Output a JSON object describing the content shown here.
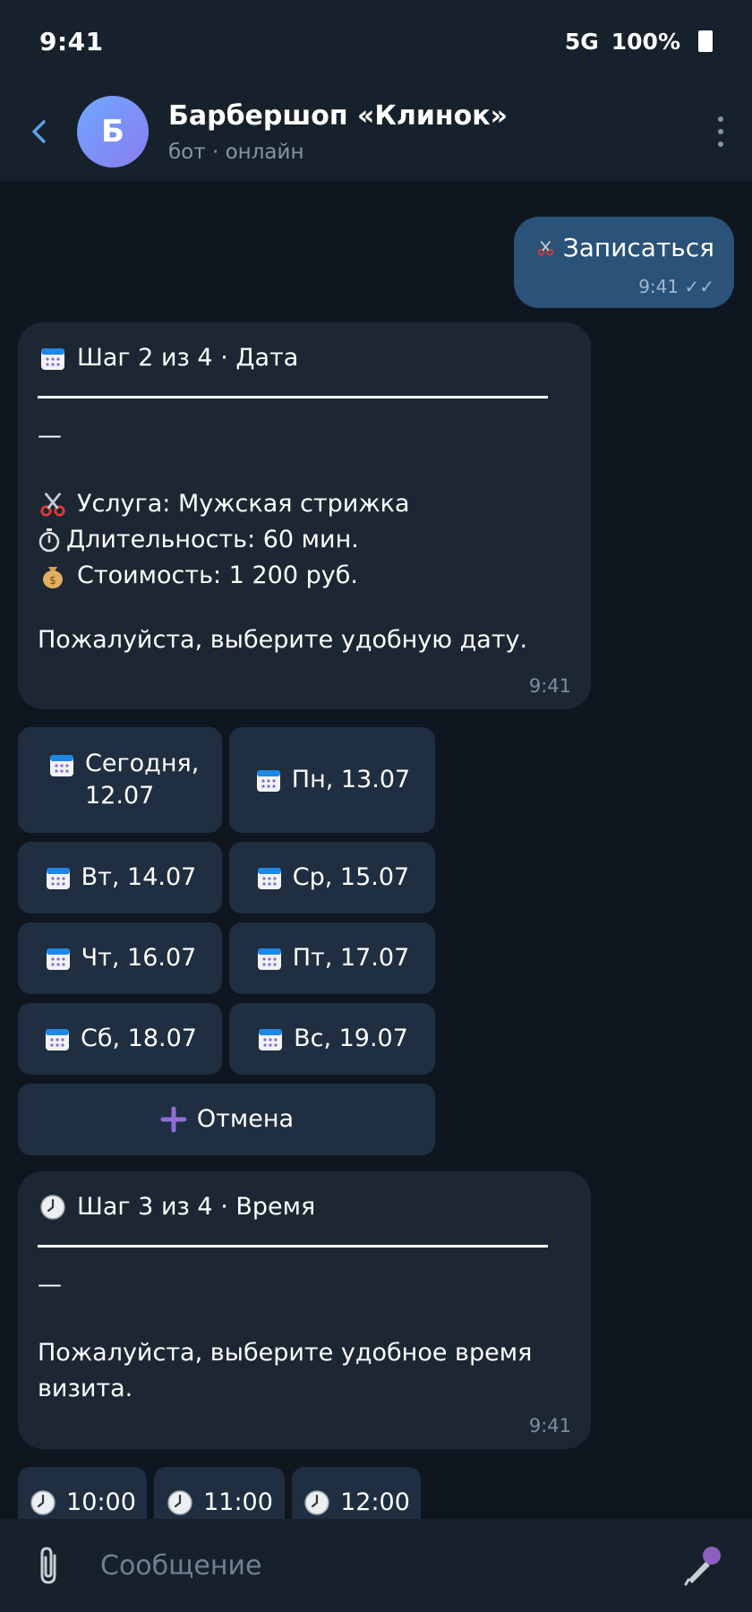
{
  "status_bar": {
    "time": "9:41",
    "network": "5G",
    "battery": "100%"
  },
  "header": {
    "avatar_letter": "Б",
    "title": "Барбершоп «Клинок»",
    "subtitle": "бот · онлайн"
  },
  "outgoing": {
    "text": "Записаться",
    "time": "9:41 ✓✓"
  },
  "step2": {
    "title": "Шаг 2 из 4 · Дата",
    "dash": "—",
    "service": "Услуга: Мужская стрижка",
    "duration": "Длительность: 60 мин.",
    "price": "Стоимость: 1 200 руб.",
    "prompt": "Пожалуйста, выберите удобную дату.",
    "time": "9:41"
  },
  "date_buttons": [
    "Сегодня, 12.07",
    "Пн, 13.07",
    "Вт, 14.07",
    "Ср, 15.07",
    "Чт, 16.07",
    "Пт, 17.07",
    "Сб, 18.07",
    "Вс, 19.07"
  ],
  "cancel_button": "Отмена",
  "step3": {
    "title": "Шаг 3 из 4 · Время",
    "dash": "—",
    "prompt": "Пожалуйста, выберите удобное время визита.",
    "time": "9:41"
  },
  "time_buttons": [
    "10:00",
    "11:00",
    "12:00"
  ],
  "composer": {
    "placeholder": "Сообщение"
  },
  "colors": {
    "background": "#0f1620",
    "bar": "#17212b",
    "outgoing_bubble": "#2b5278",
    "incoming_bubble": "#1c2733",
    "button": "#1f2e40"
  }
}
